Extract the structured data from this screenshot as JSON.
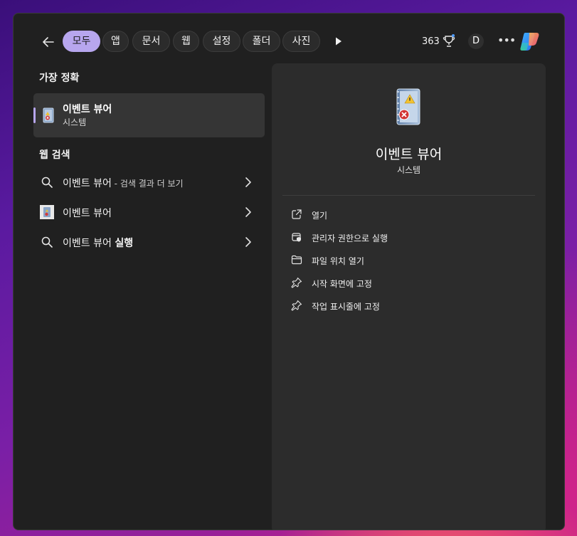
{
  "filters": {
    "tabs": [
      {
        "label": "모두",
        "active": true
      },
      {
        "label": "앱"
      },
      {
        "label": "문서"
      },
      {
        "label": "웹"
      },
      {
        "label": "설정"
      },
      {
        "label": "폴더"
      },
      {
        "label": "사진"
      }
    ]
  },
  "header": {
    "points": "363",
    "avatar": "D"
  },
  "best_match": {
    "heading": "가장 정확",
    "item": {
      "title": "이벤트 뷰어",
      "subtitle": "시스템"
    }
  },
  "web_search": {
    "heading": "웹 검색",
    "items": [
      {
        "text": "이벤트 뷰어",
        "suffix": " - 검색 결과 더 보기",
        "icon": "search-icon"
      },
      {
        "text": "이벤트 뷰어",
        "suffix": "",
        "icon": "event-viewer-icon"
      },
      {
        "text": "이벤트 뷰어 ",
        "bold": "실행",
        "icon": "search-icon"
      }
    ]
  },
  "detail": {
    "title": "이벤트 뷰어",
    "subtitle": "시스템",
    "actions": [
      {
        "label": "열기",
        "icon": "open-icon"
      },
      {
        "label": "관리자 권한으로 실행",
        "icon": "admin-shield-icon"
      },
      {
        "label": "파일 위치 열기",
        "icon": "folder-icon"
      },
      {
        "label": "시작 화면에 고정",
        "icon": "pin-icon"
      },
      {
        "label": "작업 표시줄에 고정",
        "icon": "pin-icon"
      }
    ]
  },
  "colors": {
    "accent": "#b7a6ee",
    "panel": "#202020",
    "detail_pane": "#2c2c2c"
  }
}
